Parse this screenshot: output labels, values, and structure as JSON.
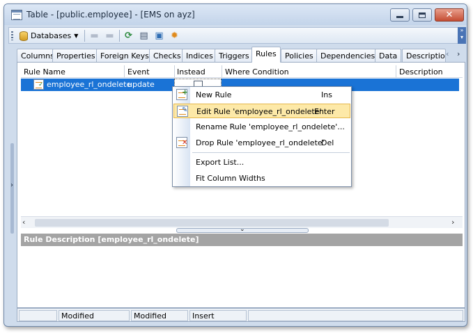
{
  "window": {
    "title": "Table - [public.employee] - [EMS on ayz]"
  },
  "toolbar": {
    "databases_label": "Databases"
  },
  "tabs": [
    {
      "label": "Columns"
    },
    {
      "label": "Properties"
    },
    {
      "label": "Foreign Keys"
    },
    {
      "label": "Checks"
    },
    {
      "label": "Indices"
    },
    {
      "label": "Triggers"
    },
    {
      "label": "Rules"
    },
    {
      "label": "Policies"
    },
    {
      "label": "Dependencies"
    },
    {
      "label": "Data"
    },
    {
      "label": "Descriptio"
    }
  ],
  "active_tab": "Rules",
  "grid": {
    "columns": [
      "Rule Name",
      "Event",
      "Instead",
      "Where Condition",
      "Description"
    ],
    "rows": [
      {
        "rule_name": "employee_rl_ondelete",
        "event": "update",
        "instead": false,
        "where_condition": "",
        "description": ""
      }
    ]
  },
  "context_menu": {
    "items": [
      {
        "label": "New Rule",
        "shortcut": "Ins"
      },
      {
        "label": "Edit Rule 'employee_rl_ondelete'",
        "shortcut": "Enter"
      },
      {
        "label": "Rename Rule 'employee_rl_ondelete'...",
        "shortcut": ""
      },
      {
        "label": "Drop Rule 'employee_rl_ondelete'",
        "shortcut": "Del"
      },
      {
        "label": "Export List...",
        "shortcut": ""
      },
      {
        "label": "Fit Column Widths",
        "shortcut": ""
      }
    ]
  },
  "description_panel": {
    "title": "Rule Description [employee_rl_ondelete]"
  },
  "statusbar": {
    "cells": [
      "",
      "Modified",
      "Modified",
      "Insert",
      ""
    ]
  },
  "icons": {
    "app": "table-icon",
    "databases": "database-icon",
    "refresh": "refresh-icon",
    "print": "print-icon",
    "export": "export-icon",
    "settings": "settings-icon"
  }
}
